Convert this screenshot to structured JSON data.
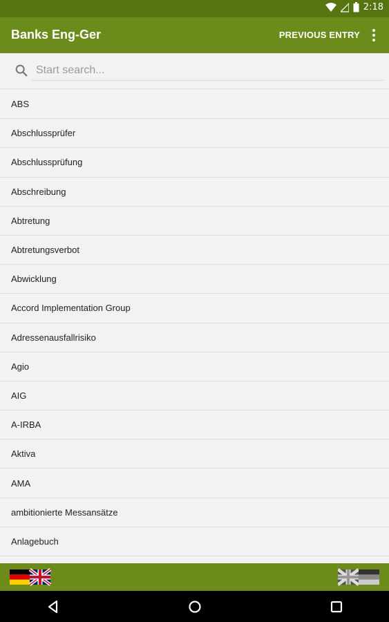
{
  "status": {
    "time": "2:18"
  },
  "appbar": {
    "title": "Banks Eng-Ger",
    "previous_entry": "PREVIOUS ENTRY"
  },
  "search": {
    "placeholder": "Start search..."
  },
  "entries": [
    "ABS",
    "Abschlussprüfer",
    "Abschlussprüfung",
    "Abschreibung",
    "Abtretung",
    "Abtretungsverbot",
    "Abwicklung",
    "Accord Implementation Group",
    "Adressenausfallrisiko",
    "Agio",
    "AIG",
    "A-IRBA",
    "Aktiva",
    "AMA",
    "ambitionierte Messansätze",
    "Anlagebuch"
  ],
  "colors": {
    "primary": "#6b8c1b",
    "status": "#56740f"
  },
  "icons": {
    "status": [
      "wifi-icon",
      "signal-icon",
      "battery-icon"
    ],
    "search": "search-icon",
    "menu": "more-vert-icon",
    "bottom_left": "flag-german-english-icon",
    "bottom_right": "flag-english-german-icon",
    "nav": [
      "back-icon",
      "home-icon",
      "recents-icon"
    ]
  }
}
